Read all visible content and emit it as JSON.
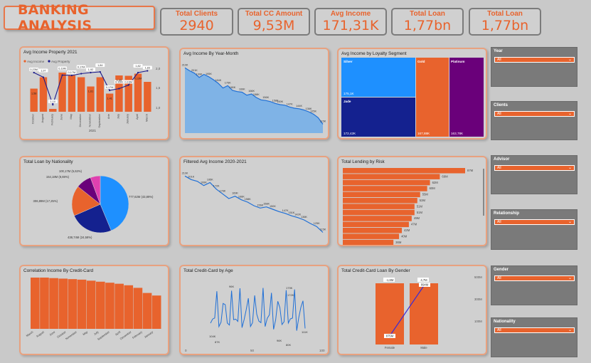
{
  "header": {
    "title": "BANKING ANALYSIS"
  },
  "kpis": [
    {
      "label": "Total Clients",
      "value": "2940"
    },
    {
      "label": "Total CC Amount",
      "value": "9,53M"
    },
    {
      "label": "Avg Income",
      "value": "171,31K"
    },
    {
      "label": "Total Loan",
      "value": "1,77bn"
    },
    {
      "label": "Total Loan",
      "value": "1,77bn"
    }
  ],
  "cards": {
    "avg_income_property": {
      "title": "Avg Income Property 2021",
      "legend": [
        "Avg Income",
        "Avg Property"
      ],
      "axis_group": "2021",
      "y2_ticks": [
        "2,0",
        "1,5",
        "1,0"
      ]
    },
    "avg_income_year_month": {
      "title": "Avg Income By Year-Month"
    },
    "loyalty": {
      "title": "Avg Income by Loyalty Segment"
    },
    "loan_nationality": {
      "title": "Total Loan by Nationality"
    },
    "filtered_income": {
      "title": "Filtered Avg Income 2020-2021"
    },
    "lending_risk": {
      "title": "Total Lending by Risk"
    },
    "correlation": {
      "title": "Correlation Income By Credit-Card"
    },
    "credit_age": {
      "title": "Total Credit-Card by Age",
      "x_ticks": [
        "0",
        "50",
        "100"
      ]
    },
    "cc_gender": {
      "title": "Total Credit-Card Loan By Gender",
      "y2_ticks": [
        "500M",
        "300M",
        "100M"
      ]
    }
  },
  "slicers": [
    {
      "label": "Year",
      "value": "All"
    },
    {
      "label": "Clients",
      "value": "All"
    },
    {
      "label": "Advisor",
      "value": "All"
    },
    {
      "label": "Relationship",
      "value": "All"
    },
    {
      "label": "Gender",
      "value": "All"
    },
    {
      "label": "Nationality",
      "value": "All"
    }
  ],
  "icons": {
    "dropdown": "chevron-down-icon"
  },
  "colors": {
    "accent": "#e8632d",
    "blue": "#1e90ff",
    "navy": "#1a1a8c",
    "purple": "#6a007a",
    "line_area": "#7fb3e6"
  },
  "chart_data": [
    {
      "id": "avg_income_property",
      "type": "bar",
      "title": "Avg Income Property 2021",
      "categories": [
        "October",
        "August",
        "February",
        "June",
        "May",
        "December",
        "November",
        "September",
        "March",
        "July",
        "January",
        "April",
        "March"
      ],
      "category_labels": [
        "October",
        "August",
        "February",
        "June",
        "May",
        "December",
        "November",
        "September",
        "Arie",
        "July",
        "January",
        "April",
        "March"
      ],
      "series": [
        {
          "name": "Avg Income",
          "values": [
            1.55,
            1.87,
            0.98,
            2.0,
            1.92,
            1.87,
            1.61,
            1.87,
            1.41,
            1.92,
            1.91,
            1.97,
            1.74
          ]
        },
        {
          "name": "Avg Property",
          "values": [
            2.0,
            1.87,
            1.1,
            1.93,
            1.92,
            1.97,
            2.0,
            2.02,
            1.5,
            1.55,
            1.65,
            2.0,
            2.05
          ]
        }
      ],
      "data_labels": [
        "0,23M",
        "1,97",
        "1,10",
        "0,19M",
        "0,17M",
        "0,17M",
        "1,92",
        "1,84",
        "0,17M",
        "0,16M",
        "0,16M",
        "1,82",
        "1,83"
      ],
      "extra_labels": [
        "1,58",
        "1,61",
        "1,41",
        "1,45",
        "0,13M"
      ]
    },
    {
      "id": "avg_income_year_month",
      "type": "area",
      "title": "Avg Income By Year-Month",
      "values": [
        210,
        205,
        201,
        194,
        199,
        195,
        190,
        184,
        176,
        180,
        172,
        170,
        169,
        164,
        166,
        160,
        156,
        155,
        153,
        150,
        148,
        147,
        144,
        142,
        141,
        139,
        136,
        132,
        126,
        115
      ],
      "data_labels": [
        "210K",
        "201K",
        "199K",
        "195K",
        "184K",
        "176K",
        "180K",
        "169K",
        "166K",
        "158K",
        "156K",
        "158K",
        "150K",
        "147K",
        "144K",
        "136K",
        "125K",
        "115K"
      ]
    },
    {
      "id": "loyalty",
      "type": "table",
      "title": "Avg Income by Loyalty Segment",
      "segments": [
        {
          "name": "Silver",
          "value": "175,1K"
        },
        {
          "name": "Jade",
          "value": "172,42K"
        },
        {
          "name": "Gold",
          "value": "167,88K"
        },
        {
          "name": "Platinum",
          "value": "163,78K"
        }
      ]
    },
    {
      "id": "loan_nationality",
      "type": "pie",
      "title": "Total Loan by Nationality",
      "values": [
        777.62,
        438.74,
        306.89,
        154.18,
        100.17
      ],
      "slice_labels": [
        "777,62M (43,89%)",
        "438,74M (24,58%)",
        "306,89M (17,25%)",
        "154,18M (8,69%)",
        "100,17M (5,63%)"
      ]
    },
    {
      "id": "filtered_income",
      "type": "line",
      "title": "Filtered Avg Income 2020-2021",
      "values": [
        210,
        204,
        201,
        194,
        199,
        188,
        180,
        172,
        176,
        170,
        166,
        160,
        156,
        158,
        154,
        150,
        147,
        143,
        140,
        136,
        130,
        125,
        115
      ],
      "data_labels": [
        "210K",
        "201K",
        "199K",
        "195K",
        "172K",
        "176K",
        "169K",
        "166K",
        "158K",
        "156K",
        "158K",
        "150K",
        "147K",
        "151K",
        "142K",
        "136K",
        "125K",
        "115K"
      ]
    },
    {
      "id": "lending_risk",
      "type": "bar",
      "title": "Total Lending by Risk",
      "values": [
        87,
        69,
        62,
        60,
        55,
        53,
        51,
        51,
        49,
        47,
        42,
        40,
        36
      ],
      "data_labels": [
        "87M",
        "69M",
        "62M",
        "60M",
        "55M",
        "53M",
        "51M",
        "51M",
        "49M",
        "47M",
        "42M",
        "40M",
        "36M"
      ]
    },
    {
      "id": "correlation",
      "type": "bar",
      "title": "Correlation Income By Credit-Card",
      "categories": [
        "March",
        "August",
        "June",
        "October",
        "November",
        "May",
        "July",
        "September",
        "April",
        "December",
        "February",
        "January"
      ],
      "values": [
        100,
        100,
        99,
        98,
        97,
        96,
        94,
        92,
        90,
        88,
        85,
        80,
        70,
        65
      ]
    },
    {
      "id": "credit_age",
      "type": "line",
      "title": "Total Credit-Card by Age",
      "xlim": [
        0,
        100
      ],
      "x_ticks": [
        "0",
        "50",
        "100"
      ],
      "data_labels": [
        "104K",
        "87K",
        "96K",
        "179K",
        "172K",
        "96K",
        "80K",
        "111K"
      ]
    },
    {
      "id": "cc_gender",
      "type": "bar",
      "title": "Total Credit-Card Loan By Gender",
      "categories": [
        "Female",
        "Male"
      ],
      "series": [
        {
          "values": [
            -1.6,
            4.7
          ]
        },
        {
          "values": [
            875,
            894
          ]
        }
      ],
      "bar_labels": [
        "-1,6M",
        "4,7M"
      ],
      "line_labels": [
        "875M",
        "894M"
      ],
      "y2_ticks": [
        "500M",
        "300M",
        "100M"
      ]
    }
  ]
}
